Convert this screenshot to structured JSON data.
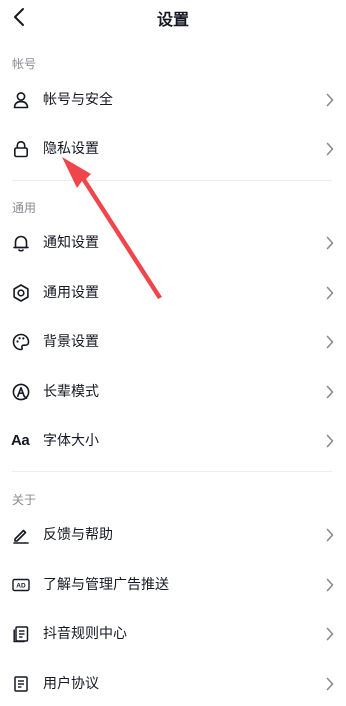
{
  "header": {
    "title": "设置",
    "back_icon": "chevron-left-icon"
  },
  "sections": {
    "account": {
      "label": "帐号",
      "items": [
        {
          "label": "帐号与安全",
          "icon": "person-icon"
        },
        {
          "label": "隐私设置",
          "icon": "lock-icon"
        }
      ]
    },
    "general": {
      "label": "通用",
      "items": [
        {
          "label": "通知设置",
          "icon": "bell-icon"
        },
        {
          "label": "通用设置",
          "icon": "gear-icon"
        },
        {
          "label": "背景设置",
          "icon": "palette-icon"
        },
        {
          "label": "长辈模式",
          "icon": "elder-mode-icon"
        },
        {
          "label": "字体大小",
          "icon": "font-size-icon",
          "icon_text": "Aa"
        }
      ]
    },
    "about": {
      "label": "关于",
      "items": [
        {
          "label": "反馈与帮助",
          "icon": "pencil-icon"
        },
        {
          "label": "了解与管理广告推送",
          "icon": "ad-icon",
          "icon_text": "AD"
        },
        {
          "label": "抖音规则中心",
          "icon": "document-icon"
        },
        {
          "label": "用户协议",
          "icon": "agreement-icon"
        }
      ]
    }
  },
  "annotation": {
    "type": "arrow",
    "color": "#f0454a",
    "points_to": "隐私设置"
  }
}
